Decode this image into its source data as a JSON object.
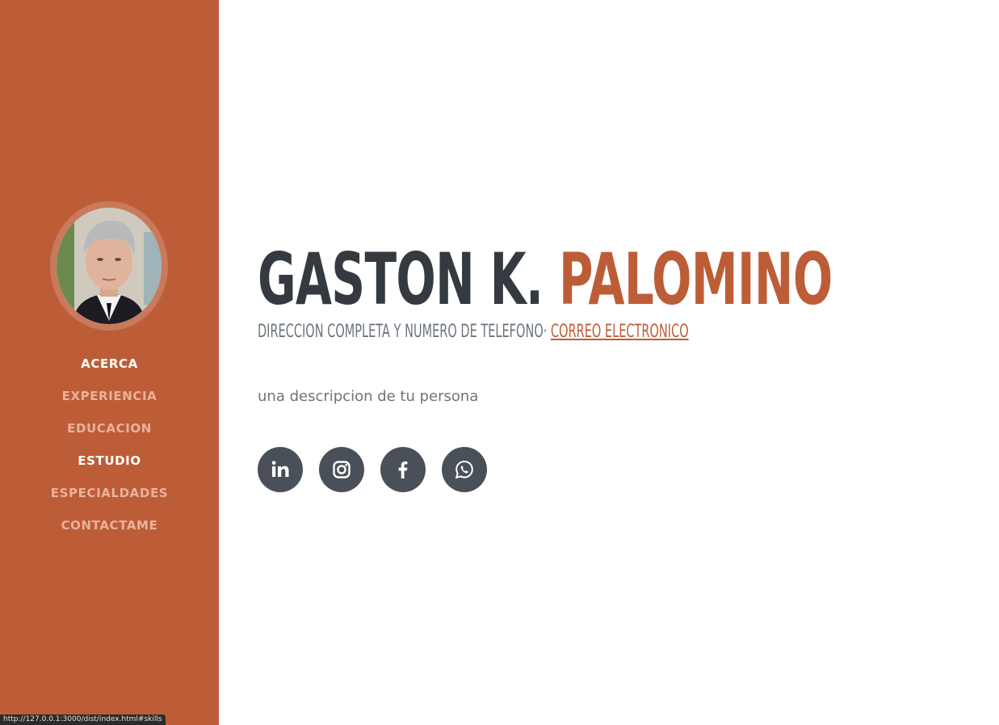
{
  "profile": {
    "first_name": "GASTON K.",
    "last_name": "PALOMINO",
    "address_phone": "DIRECCION COMPLETA Y NUMERO DE TELEFONO·",
    "email_link": "CORREO ELECTRONICO",
    "description": "una descripcion de tu persona"
  },
  "nav": {
    "items": [
      {
        "label": "ACERCA"
      },
      {
        "label": "EXPERIENCIA"
      },
      {
        "label": "EDUCACION"
      },
      {
        "label": "ESTUDIO"
      },
      {
        "label": "ESPECIALDADES"
      },
      {
        "label": "CONTACTAME"
      }
    ]
  },
  "social": {
    "icons": [
      "linkedin-icon",
      "instagram-icon",
      "facebook-icon",
      "whatsapp-icon"
    ]
  },
  "status_bar": {
    "url": "http://127.0.0.1:3000/dist/index.html#skills"
  },
  "colors": {
    "primary": "#bd5d38",
    "dark": "#343a40",
    "muted": "#6c757d",
    "social_bg": "#495057"
  }
}
